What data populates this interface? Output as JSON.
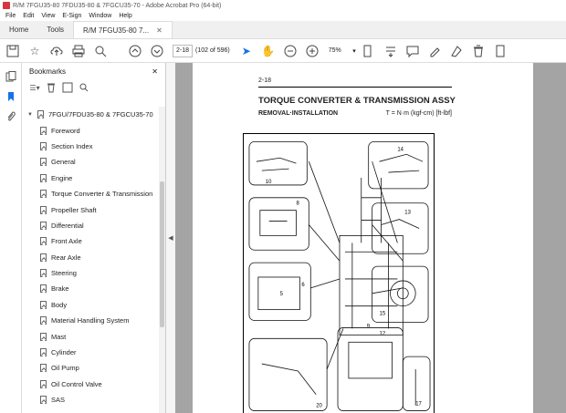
{
  "window": {
    "title": "R/M 7FGU35-80 7FDU35-80 & 7FGCU35-70 - Adobe Acrobat Pro (64-bit)"
  },
  "menu": [
    "File",
    "Edit",
    "View",
    "E-Sign",
    "Window",
    "Help"
  ],
  "tabs": [
    {
      "label": "Home"
    },
    {
      "label": "Tools"
    },
    {
      "label": "R/M 7FGU35-80 7..."
    }
  ],
  "toolbar": {
    "page_value": "2-18",
    "page_count": "(102 of 596)",
    "zoom": "75%"
  },
  "bookmarks": {
    "title": "Bookmarks",
    "root": "7FGU/7FDU35-80 & 7FGCU35-70",
    "items": [
      "Foreword",
      "Section Index",
      "General",
      "Engine",
      "Torque Converter & Transmission",
      "Propeller Shaft",
      "Differential",
      "Front Axle",
      "Rear Axle",
      "Steering",
      "Brake",
      "Body",
      "Material Handling System",
      "Mast",
      "Cylinder",
      "Oil Pump",
      "Oil Control Valve",
      "SAS"
    ]
  },
  "document": {
    "page_number": "2-18",
    "title": "TORQUE CONVERTER & TRANSMISSION ASSY",
    "subtitle": "REMOVAL·INSTALLATION",
    "units": "T = N·m (kgf-cm) [ft-lbf]",
    "callouts": [
      "10",
      "14",
      "8",
      "13",
      "5",
      "6",
      "15",
      "9",
      "12",
      "17",
      "20"
    ]
  }
}
